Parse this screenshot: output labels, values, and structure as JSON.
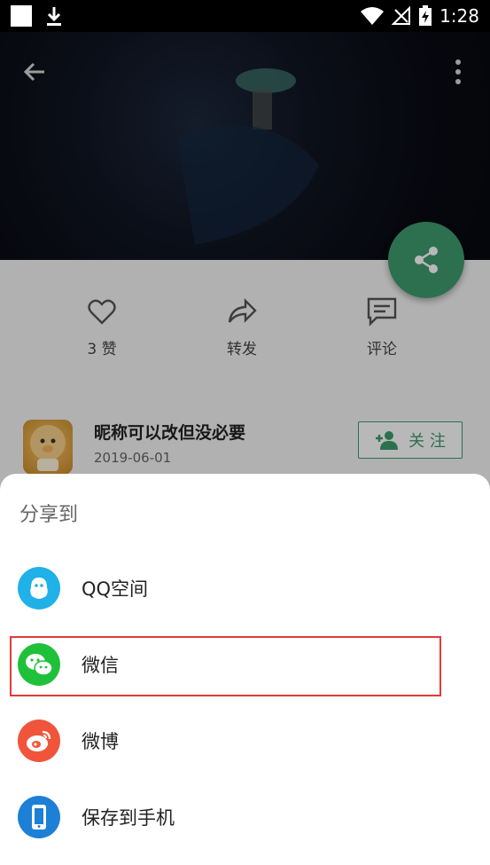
{
  "status_bar": {
    "time": "1:28"
  },
  "actions": [
    {
      "icon": "heart-icon",
      "label": "3 赞"
    },
    {
      "icon": "forward-icon",
      "label": "转发"
    },
    {
      "icon": "comment-icon",
      "label": "评论"
    }
  ],
  "post": {
    "username": "昵称可以改但没必要",
    "date": "2019-06-01",
    "follow_label": "关 注"
  },
  "share_sheet": {
    "title": "分享到",
    "items": [
      {
        "label": "QQ空间",
        "icon": "qq-icon",
        "color": "#1fb1e8"
      },
      {
        "label": "微信",
        "icon": "wechat-icon",
        "color": "#20c13a"
      },
      {
        "label": "微博",
        "icon": "weibo-icon",
        "color": "#f0553b"
      },
      {
        "label": "保存到手机",
        "icon": "phone-icon",
        "color": "#1d7fd6"
      }
    ]
  },
  "colors": {
    "accent": "#3f9c6e",
    "highlight": "#e23a3a"
  }
}
